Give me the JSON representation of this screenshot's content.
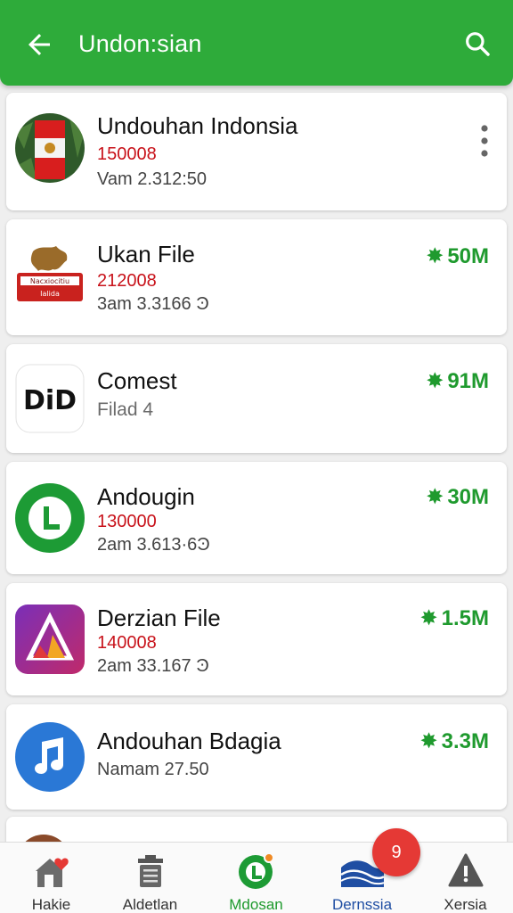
{
  "header": {
    "title": "Undon:sian",
    "back_icon": "arrow-left-icon",
    "search_icon": "search-icon"
  },
  "colors": {
    "primary": "#2eab3a",
    "accent_size": "#1f9a2e",
    "code_red": "#c8121a",
    "badge": "#e53935"
  },
  "items": [
    {
      "name": "Undouhan Indonsia",
      "code": "150008",
      "meta": "Vam 2.312:50",
      "size": "",
      "has_more": true,
      "icon": "flag-icon"
    },
    {
      "name": "Ukan File",
      "code": "212008",
      "meta": "3am 3.3166 Ͽ",
      "size": "50M",
      "icon": "map-emblem-icon",
      "icon_text": "Nacxiocitiu Ialida"
    },
    {
      "name": "Comest",
      "code": "",
      "meta": "Filad 4",
      "size": "91M",
      "icon": "did-logo-icon",
      "icon_text": "DiD"
    },
    {
      "name": "Andougin",
      "code": "130000",
      "meta": "2am 3.613·6Ͽ",
      "size": "30M",
      "icon": "letter-l-icon"
    },
    {
      "name": "Derzian File",
      "code": "140008",
      "meta": "2am 33.167 Ͽ",
      "size": "1.5M",
      "icon": "triangle-logo-icon"
    },
    {
      "name": "Andouhan Bdagia",
      "code": "",
      "meta": "Namam 27.50",
      "size": "3.3M",
      "icon": "music-note-icon"
    }
  ],
  "nav": [
    {
      "label": "Hakie",
      "icon": "home-heart-icon"
    },
    {
      "label": "Aldetlan",
      "icon": "trash-icon"
    },
    {
      "label": "Mdosan",
      "icon": "app-l-icon",
      "active": true
    },
    {
      "label": "Dernssia",
      "icon": "waves-icon",
      "badge": "9"
    },
    {
      "label": "Xersia",
      "icon": "warning-icon"
    }
  ]
}
